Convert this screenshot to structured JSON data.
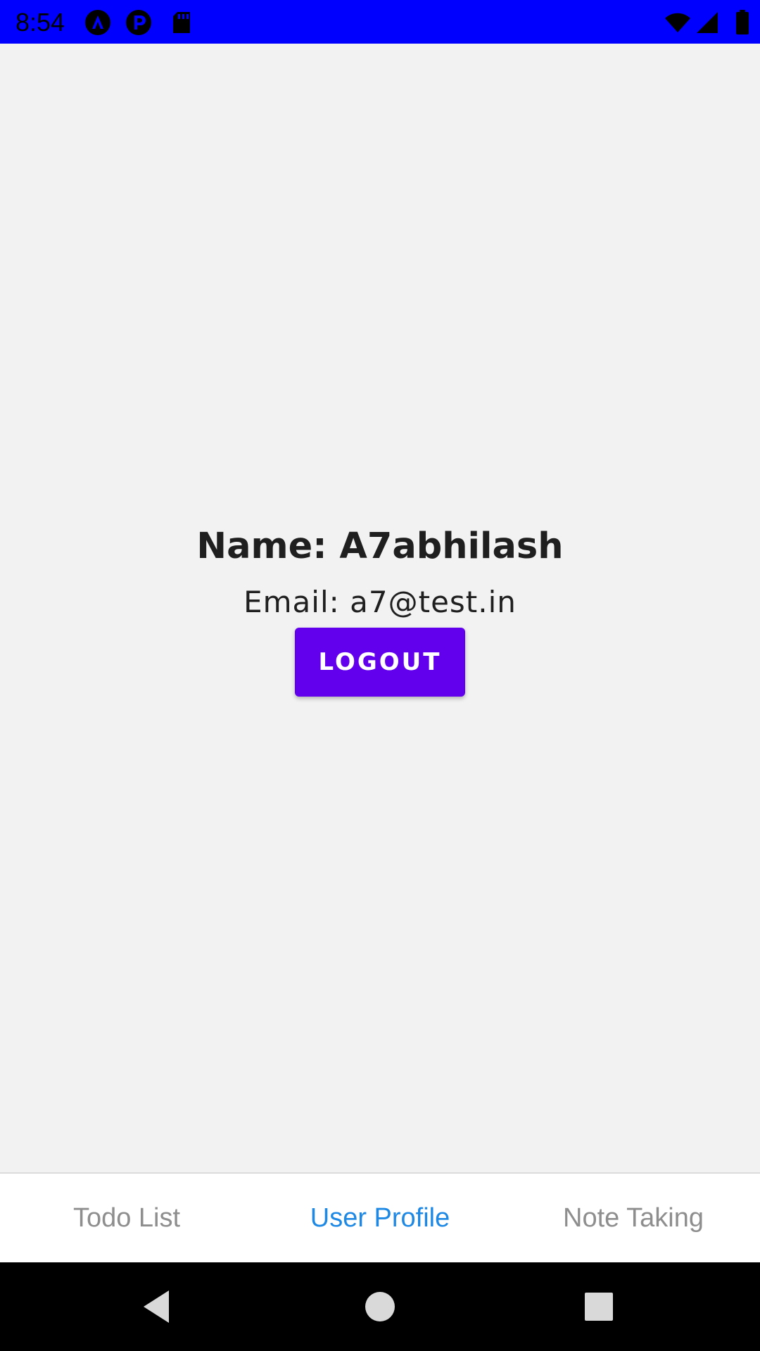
{
  "status_bar": {
    "time": "8:54",
    "left_icons": [
      "a-circle-icon",
      "p-circle-icon",
      "sd-card-icon"
    ],
    "right_icons": [
      "wifi-icon",
      "signal-icon",
      "battery-icon"
    ],
    "background_color": "#0000ff"
  },
  "profile": {
    "name": "Name: A7abhilash",
    "email": "Email: a7@test.in",
    "logout_label": "LOGOUT",
    "button_color": "#6200ee"
  },
  "tabs": [
    {
      "label": "Todo List",
      "active": false
    },
    {
      "label": "User Profile",
      "active": true
    },
    {
      "label": "Note Taking",
      "active": false
    }
  ],
  "colors": {
    "active_tab": "#1e88e5",
    "inactive_tab": "#8e8e8e",
    "background": "#f2f2f2"
  },
  "nav_bar": {
    "icons": [
      "back-icon",
      "home-icon",
      "recents-icon"
    ]
  }
}
